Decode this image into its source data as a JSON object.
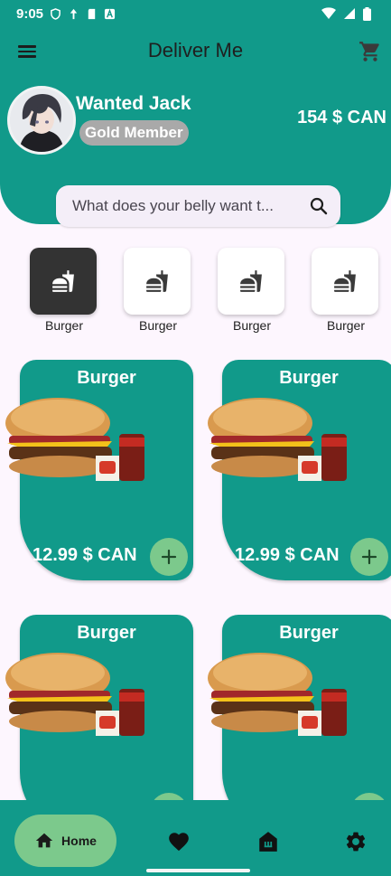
{
  "status_bar": {
    "time": "9:05"
  },
  "appbar": {
    "title": "Deliver Me"
  },
  "profile": {
    "name": "Wanted Jack",
    "membership": "Gold Member",
    "balance": "154 $ CAN"
  },
  "search": {
    "placeholder": "What does your belly want t..."
  },
  "categories": [
    {
      "label": "Burger",
      "active": true
    },
    {
      "label": "Burger",
      "active": false
    },
    {
      "label": "Burger",
      "active": false
    },
    {
      "label": "Burger",
      "active": false
    }
  ],
  "products": [
    {
      "title": "Burger",
      "price": "12.99 $ CAN"
    },
    {
      "title": "Burger",
      "price": "12.99 $ CAN"
    },
    {
      "title": "Burger",
      "price": ""
    },
    {
      "title": "Burger",
      "price": ""
    }
  ],
  "bottom_nav": {
    "home_label": "Home"
  },
  "colors": {
    "brand": "#119a8a",
    "accent": "#7cc98c",
    "badge": "#a9a9a9",
    "background": "#fdf6fe"
  },
  "icons": {
    "menu": "menu-icon",
    "cart": "cart-icon",
    "search": "search-icon",
    "category": "fastfood-icon",
    "add": "plus-icon",
    "home": "home-icon",
    "favorites": "heart-icon",
    "store": "storefront-icon",
    "settings": "gear-icon"
  }
}
